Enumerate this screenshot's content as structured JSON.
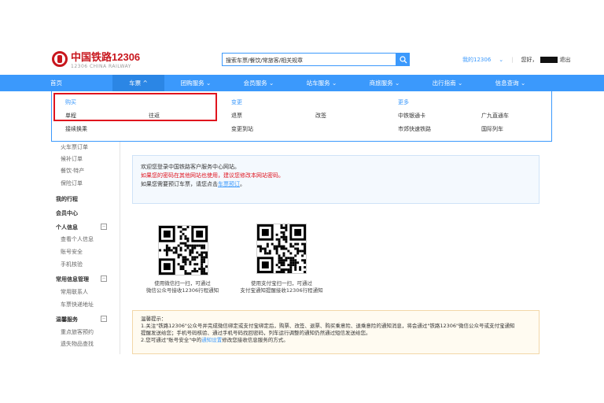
{
  "logo": {
    "cn": "中国铁路12306",
    "en": "12306 CHINA RAILWAY"
  },
  "search": {
    "value": "搜索车票/餐饮/常旅客/相关规章"
  },
  "top_links": {
    "mine": "我的12306",
    "greeting": "您好，",
    "logout": "退出"
  },
  "nav": [
    "首页",
    "车票",
    "团购服务",
    "会员服务",
    "站车服务",
    "商旅服务",
    "出行指南",
    "信息查询"
  ],
  "dropdown": {
    "buy_head": "购买",
    "change_head": "变更",
    "more_head": "更多",
    "buy_items": [
      "单程",
      "往返",
      "接续换乘"
    ],
    "change_items": [
      "退票",
      "改签",
      "变更到站"
    ],
    "more_items": [
      "中铁银通卡",
      "广九直通车",
      "市郊快速铁路",
      "国际列车"
    ]
  },
  "sidebar": {
    "orders": [
      "火车票订单",
      "候补订单",
      "餐饮·特产",
      "保险订单"
    ],
    "my_trip": "我的行程",
    "member": "会员中心",
    "personal": "个人信息",
    "personal_items": [
      "查看个人信息",
      "账号安全",
      "手机核验"
    ],
    "common": "常用信息管理",
    "common_items": [
      "常用联系人",
      "车票快递地址"
    ],
    "warm": "温馨服务",
    "warm_items": [
      "重点旅客预约",
      "遗失物品查找"
    ]
  },
  "welcome": {
    "line1": "欢迎您登录中国铁路客户服务中心网站。",
    "line2": "如果您的密码在其他网站也使用，建议您修改本网站密码。",
    "line3_pre": "如果您需要预订车票，请您点击",
    "line3_link": "车票预订",
    "line3_post": "。"
  },
  "qr": {
    "wechat_cap1": "使用微信扫一扫，可通过",
    "wechat_cap2": "微信公众号接收12306行程通知",
    "alipay_cap1": "使用支付宝扫一扫，可通过",
    "alipay_cap2": "支付宝通知提醒接收12306行程通知"
  },
  "tips": {
    "title": "温馨提示：",
    "t1": "1.关注\"铁路12306\"公众号并完成微信绑定或支付宝绑定后，购票、改签、退票、购买乘意险、退乘意险的通知消息，将会通过\"铁路12306\"微信公众号或支付宝通知",
    "t2": "提醒发送给您；手机号码核验、通过手机号码找回密码，列车运行调整的通知仍然通过短信发送给您。",
    "t3_pre": "2.您可通过\"账号安全\"中的",
    "t3_link": "通知设置",
    "t3_post": "修改您接收信息服务的方式。"
  },
  "colors": {
    "brand_red": "#c8161d",
    "nav_blue": "#3b99fc",
    "highlight_red": "#e0141e"
  }
}
